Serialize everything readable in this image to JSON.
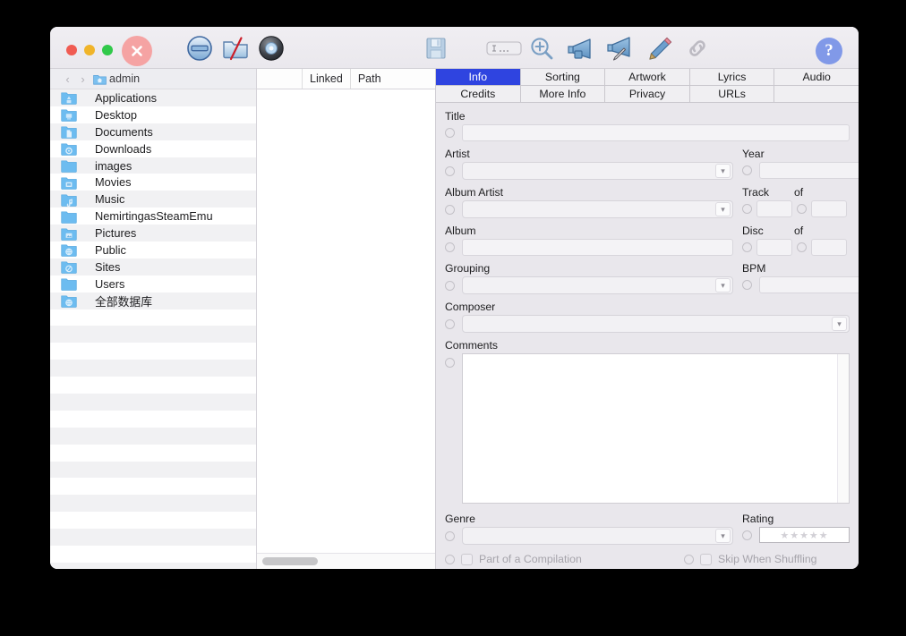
{
  "window": {
    "traffic_lights": [
      "close",
      "minimize",
      "zoom"
    ],
    "close_badge": "close-x",
    "help_label": "?"
  },
  "toolbar": {
    "left_group": [
      {
        "name": "no-entry-icon",
        "title": "Remove"
      },
      {
        "name": "folder-slash-icon",
        "title": "Folder"
      },
      {
        "name": "disc-icon",
        "title": "Disc"
      }
    ],
    "right_group": [
      {
        "name": "save-floppy-icon",
        "title": "Save"
      },
      {
        "name": "text-field-icon",
        "title": "Text Field",
        "glyph": "I . . ."
      },
      {
        "name": "zoom-in-icon",
        "title": "Zoom In"
      },
      {
        "name": "megaphone-icon",
        "title": "Announce"
      },
      {
        "name": "megaphone-edit-icon",
        "title": "Announce Edit"
      },
      {
        "name": "pencil-icon",
        "title": "Edit"
      },
      {
        "name": "link-icon",
        "title": "Link"
      }
    ]
  },
  "sidebar": {
    "breadcrumb": {
      "back": "‹",
      "forward": "›",
      "current": "admin"
    },
    "items": [
      {
        "label": "Applications",
        "icon": "folder-applications-icon"
      },
      {
        "label": "Desktop",
        "icon": "folder-desktop-icon"
      },
      {
        "label": "Documents",
        "icon": "folder-documents-icon"
      },
      {
        "label": "Downloads",
        "icon": "folder-downloads-icon"
      },
      {
        "label": "images",
        "icon": "folder-icon"
      },
      {
        "label": "Movies",
        "icon": "folder-movies-icon"
      },
      {
        "label": "Music",
        "icon": "folder-music-icon"
      },
      {
        "label": "NemirtingasSteamEmu",
        "icon": "folder-icon"
      },
      {
        "label": "Pictures",
        "icon": "folder-pictures-icon"
      },
      {
        "label": "Public",
        "icon": "folder-public-icon"
      },
      {
        "label": "Sites",
        "icon": "folder-sites-icon"
      },
      {
        "label": "Users",
        "icon": "folder-icon"
      },
      {
        "label": "全部数据库",
        "icon": "folder-public-icon"
      }
    ]
  },
  "filelist": {
    "columns": [
      "Linked",
      "Path"
    ],
    "rows": []
  },
  "tabs": {
    "row1": [
      {
        "label": "Info",
        "active": true
      },
      {
        "label": "Sorting",
        "active": false
      },
      {
        "label": "Artwork",
        "active": false
      },
      {
        "label": "Lyrics",
        "active": false
      },
      {
        "label": "Audio",
        "active": false
      }
    ],
    "row2": [
      {
        "label": "Credits",
        "active": false
      },
      {
        "label": "More Info",
        "active": false
      },
      {
        "label": "Privacy",
        "active": false
      },
      {
        "label": "URLs",
        "active": false
      },
      {
        "label": "",
        "active": false
      }
    ]
  },
  "info": {
    "title": {
      "label": "Title",
      "value": ""
    },
    "artist": {
      "label": "Artist",
      "value": ""
    },
    "year": {
      "label": "Year",
      "value": ""
    },
    "album_artist": {
      "label": "Album Artist",
      "value": ""
    },
    "track": {
      "label": "Track",
      "value": ""
    },
    "track_of": {
      "label": "of",
      "value": ""
    },
    "album": {
      "label": "Album",
      "value": ""
    },
    "disc": {
      "label": "Disc",
      "value": ""
    },
    "disc_of": {
      "label": "of",
      "value": ""
    },
    "grouping": {
      "label": "Grouping",
      "value": ""
    },
    "bpm": {
      "label": "BPM",
      "value": ""
    },
    "composer": {
      "label": "Composer",
      "value": ""
    },
    "comments": {
      "label": "Comments",
      "value": ""
    },
    "genre": {
      "label": "Genre",
      "value": ""
    },
    "rating": {
      "label": "Rating",
      "stars": "★★★★★",
      "value": 0
    },
    "compilation": {
      "label": "Part of a Compilation",
      "checked": false,
      "enabled": false
    },
    "skip_shuffle": {
      "label": "Skip When Shuffling",
      "checked": false,
      "enabled": false
    }
  },
  "colors": {
    "accent": "#2f44e0",
    "help_blue": "#8199e8",
    "close_pink": "#f5a3a3",
    "panel_bg": "#e9e7ec",
    "row_alt": "#f1f1f3"
  }
}
